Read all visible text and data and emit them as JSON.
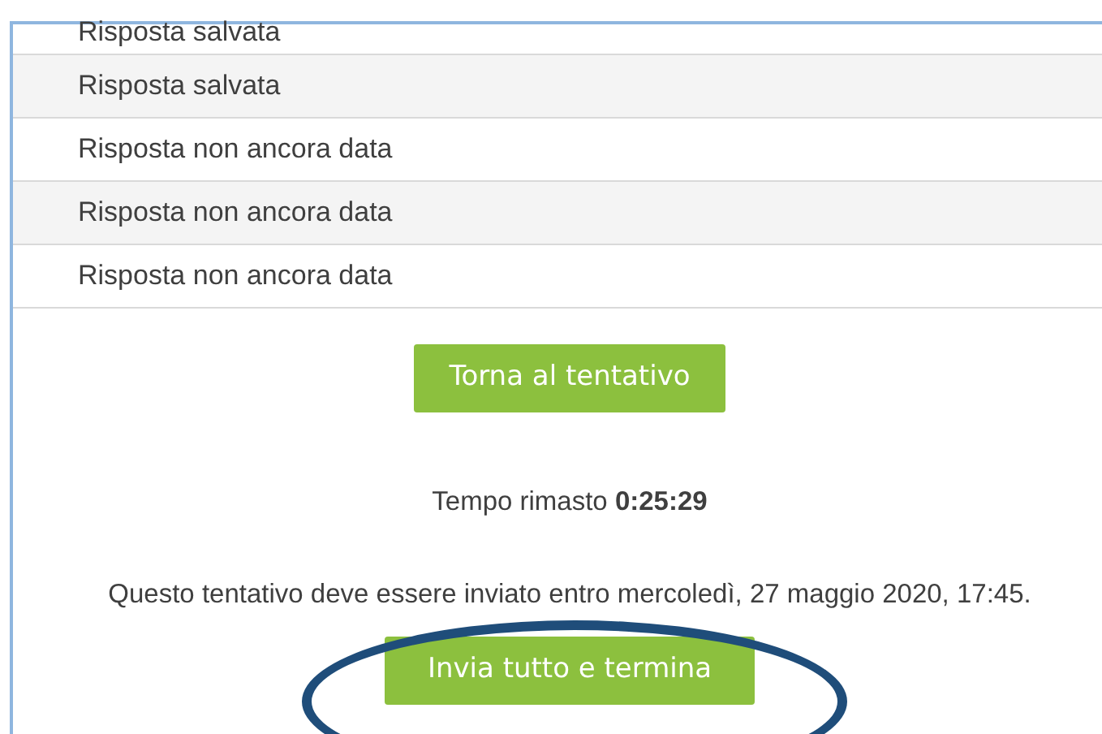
{
  "summary_rows": [
    {
      "status": "Risposta salvata"
    },
    {
      "status": "Risposta salvata"
    },
    {
      "status": "Risposta non ancora data"
    },
    {
      "status": "Risposta non ancora data"
    },
    {
      "status": "Risposta non ancora data"
    }
  ],
  "return_button": "Torna al tentativo",
  "time_left": {
    "label": "Tempo rimasto",
    "value": "0:25:29"
  },
  "deadline_notice": "Questo tentativo deve essere inviato entro mercoledì, 27 maggio 2020, 17:45.",
  "submit_button": "Invia tutto e termina"
}
